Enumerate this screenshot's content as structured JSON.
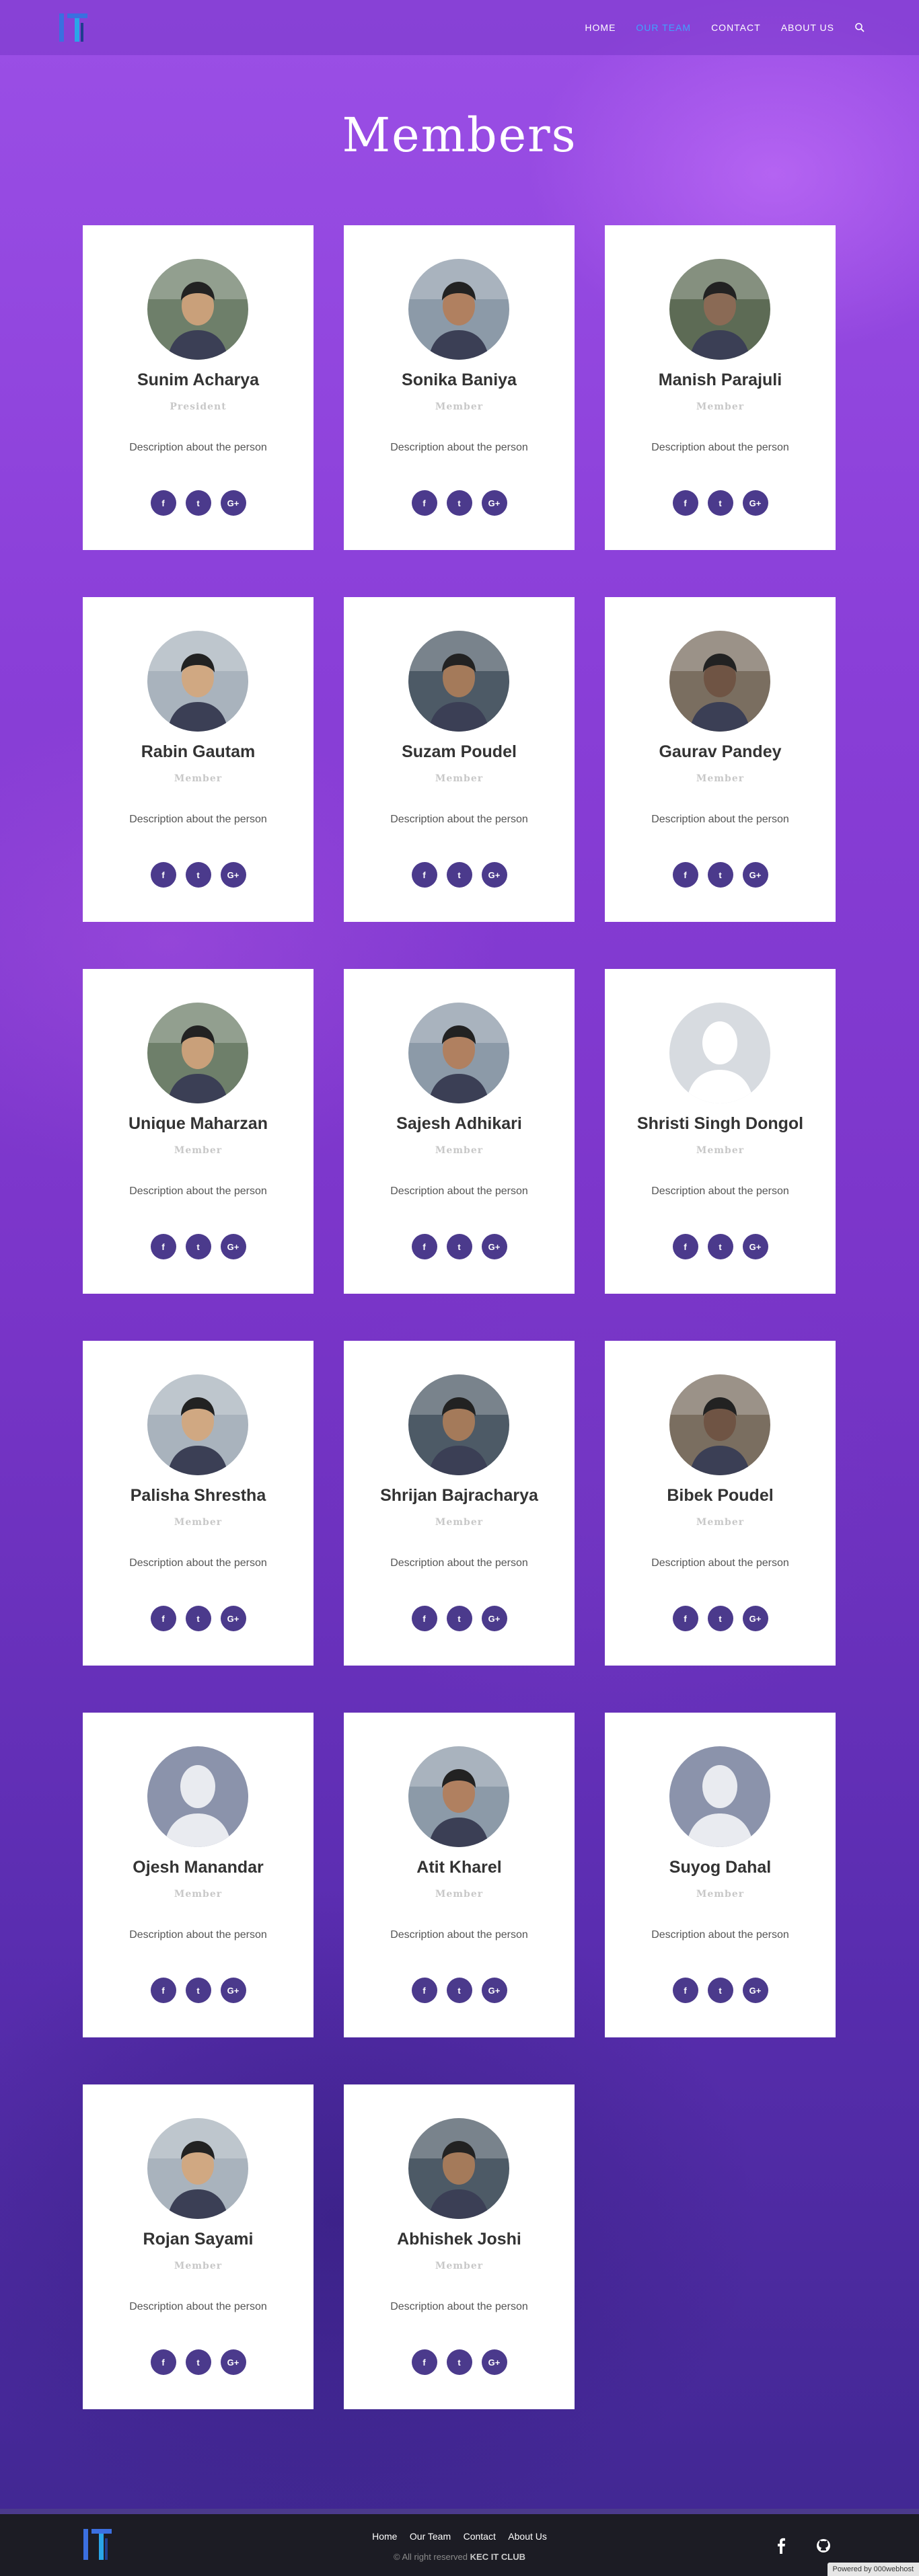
{
  "nav": {
    "items": [
      {
        "label": "HOME",
        "active": false
      },
      {
        "label": "OUR TEAM",
        "active": true
      },
      {
        "label": "CONTACT",
        "active": false
      },
      {
        "label": "ABOUT US",
        "active": false
      }
    ],
    "search_icon": "search-icon",
    "active_color": "#3fa3ff"
  },
  "page": {
    "title": "Members"
  },
  "members": [
    {
      "name": "Sunim Acharya",
      "role": "President",
      "desc": "Description about the person",
      "photo": "photo"
    },
    {
      "name": "Sonika Baniya",
      "role": "Member",
      "desc": "Description about the person",
      "photo": "photo"
    },
    {
      "name": "Manish Parajuli",
      "role": "Member",
      "desc": "Description about the person",
      "photo": "photo"
    },
    {
      "name": "Rabin Gautam",
      "role": "Member",
      "desc": "Description about the person",
      "photo": "photo"
    },
    {
      "name": "Suzam Poudel",
      "role": "Member",
      "desc": "Description about the person",
      "photo": "photo"
    },
    {
      "name": "Gaurav Pandey",
      "role": "Member",
      "desc": "Description about the person",
      "photo": "photo"
    },
    {
      "name": "Unique Maharzan",
      "role": "Member",
      "desc": "Description about the person",
      "photo": "photo"
    },
    {
      "name": "Sajesh Adhikari",
      "role": "Member",
      "desc": "Description about the person",
      "photo": "photo"
    },
    {
      "name": "Shristi Singh Dongol",
      "role": "Member",
      "desc": "Description about the person",
      "photo": "placeholder-light"
    },
    {
      "name": "Palisha Shrestha",
      "role": "Member",
      "desc": "Description about the person",
      "photo": "photo"
    },
    {
      "name": "Shrijan Bajracharya",
      "role": "Member",
      "desc": "Description about the person",
      "photo": "photo"
    },
    {
      "name": "Bibek Poudel",
      "role": "Member",
      "desc": "Description about the person",
      "photo": "photo"
    },
    {
      "name": "Ojesh Manandar",
      "role": "Member",
      "desc": "Description about the person",
      "photo": "placeholder-dark"
    },
    {
      "name": "Atit Kharel",
      "role": "Member",
      "desc": "Description about the person",
      "photo": "photo"
    },
    {
      "name": "Suyog Dahal",
      "role": "Member",
      "desc": "Description about the person",
      "photo": "placeholder-dark"
    },
    {
      "name": "Rojan Sayami",
      "role": "Member",
      "desc": "Description about the person",
      "photo": "photo"
    },
    {
      "name": "Abhishek Joshi",
      "role": "Member",
      "desc": "Description about the person",
      "photo": "photo"
    }
  ],
  "social_icons": [
    {
      "icon": "facebook-icon",
      "glyph": "f"
    },
    {
      "icon": "twitter-icon",
      "glyph": "t"
    },
    {
      "icon": "google-plus-icon",
      "glyph": "G+"
    }
  ],
  "footer": {
    "links": [
      "Home",
      "Our Team",
      "Contact",
      "About Us"
    ],
    "copyright_prefix": "© All right reserved",
    "copyright_brand": "KEC IT CLUB",
    "icons": [
      "facebook-icon",
      "github-icon"
    ],
    "powered_by": "Powered by",
    "powered_brand": "000webhost"
  },
  "colors": {
    "accent": "#4b3a8c",
    "card_bg": "#ffffff",
    "footer_bg": "#1c1c24"
  }
}
